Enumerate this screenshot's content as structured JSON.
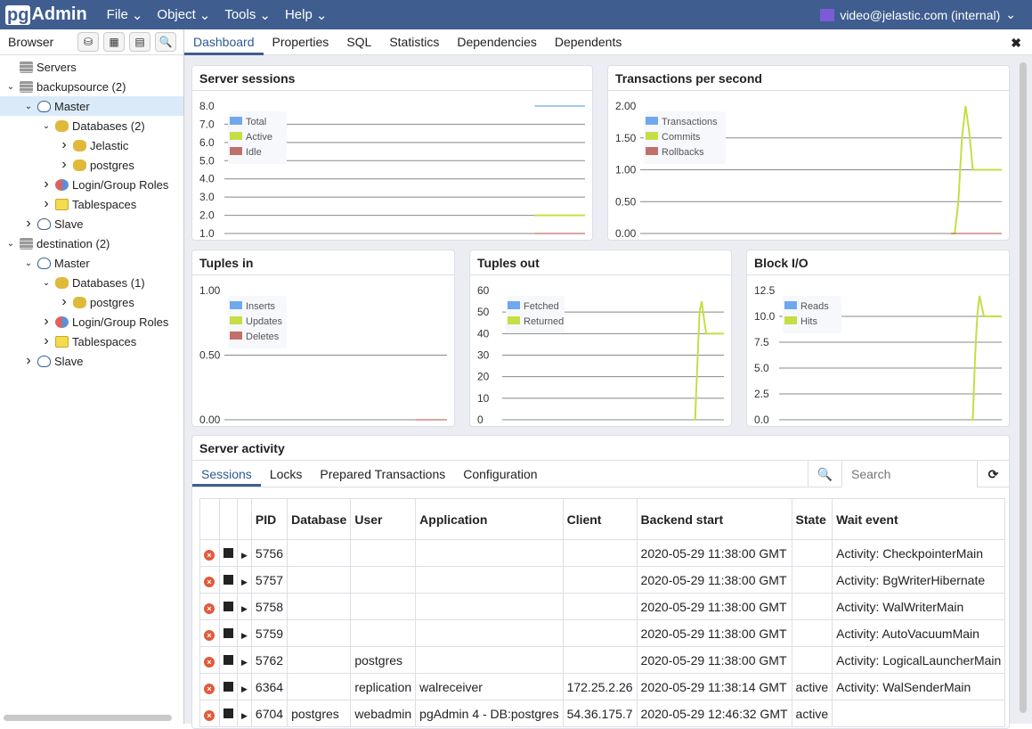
{
  "nav": {
    "logo": "pgAdmin",
    "logo_pg": "pg",
    "logo_rest": "Admin",
    "menus": [
      "File",
      "Object",
      "Tools",
      "Help"
    ],
    "user": "video@jelastic.com (internal)"
  },
  "browser": {
    "title": "Browser",
    "tree": [
      {
        "label": "Servers",
        "level": 0,
        "icon": "servers",
        "arrow": ""
      },
      {
        "label": "backupsource (2)",
        "level": 0,
        "icon": "servers",
        "arrow": "down"
      },
      {
        "label": "Master",
        "level": 1,
        "icon": "pg",
        "arrow": "down",
        "selected": true
      },
      {
        "label": "Databases (2)",
        "level": 2,
        "icon": "db",
        "arrow": "down"
      },
      {
        "label": "Jelastic",
        "level": 3,
        "icon": "db",
        "arrow": "right"
      },
      {
        "label": "postgres",
        "level": 3,
        "icon": "db",
        "arrow": "right"
      },
      {
        "label": "Login/Group Roles",
        "level": 2,
        "icon": "role",
        "arrow": "right"
      },
      {
        "label": "Tablespaces",
        "level": 2,
        "icon": "ts",
        "arrow": "right"
      },
      {
        "label": "Slave",
        "level": 1,
        "icon": "pg",
        "arrow": "right"
      },
      {
        "label": "destination (2)",
        "level": 0,
        "icon": "servers",
        "arrow": "down"
      },
      {
        "label": "Master",
        "level": 1,
        "icon": "pg",
        "arrow": "down"
      },
      {
        "label": "Databases (1)",
        "level": 2,
        "icon": "db",
        "arrow": "down"
      },
      {
        "label": "postgres",
        "level": 3,
        "icon": "db",
        "arrow": "right"
      },
      {
        "label": "Login/Group Roles",
        "level": 2,
        "icon": "role",
        "arrow": "right"
      },
      {
        "label": "Tablespaces",
        "level": 2,
        "icon": "ts",
        "arrow": "right"
      },
      {
        "label": "Slave",
        "level": 1,
        "icon": "pg",
        "arrow": "right"
      }
    ]
  },
  "tabs": [
    "Dashboard",
    "Properties",
    "SQL",
    "Statistics",
    "Dependencies",
    "Dependents"
  ],
  "colors": {
    "nav": "#3f5e8f",
    "blue": "#6fa8ef",
    "green": "#c6de45",
    "red": "#c0706a"
  },
  "chart_data": [
    {
      "type": "line",
      "title": "Server sessions",
      "yticks": [
        "8.0",
        "7.0",
        "6.0",
        "5.0",
        "4.0",
        "3.0",
        "2.0",
        "1.0"
      ],
      "ylim": [
        1,
        8
      ],
      "xlim": [
        0,
        100
      ],
      "series": [
        {
          "name": "Total",
          "color": "#6fa8ef",
          "points": [
            [
              86,
              8
            ],
            [
              100,
              8
            ]
          ]
        },
        {
          "name": "Active",
          "color": "#c6de45",
          "points": [
            [
              86,
              2
            ],
            [
              100,
              2
            ]
          ]
        },
        {
          "name": "Idle",
          "color": "#c0706a",
          "points": [
            [
              86,
              1
            ],
            [
              100,
              1
            ]
          ]
        }
      ]
    },
    {
      "type": "line",
      "title": "Transactions per second",
      "yticks": [
        "2.00",
        "1.50",
        "1.00",
        "0.50",
        "0.00"
      ],
      "ylim": [
        0,
        2
      ],
      "xlim": [
        0,
        100
      ],
      "series": [
        {
          "name": "Transactions",
          "color": "#6fa8ef",
          "points": []
        },
        {
          "name": "Commits",
          "color": "#c6de45",
          "points": [
            [
              86,
              0
            ],
            [
              87,
              0
            ],
            [
              88,
              0.5
            ],
            [
              89,
              1.5
            ],
            [
              90,
              2
            ],
            [
              91,
              1.6
            ],
            [
              92,
              1
            ],
            [
              100,
              1
            ]
          ]
        },
        {
          "name": "Rollbacks",
          "color": "#c0706a",
          "points": [
            [
              86,
              0
            ],
            [
              100,
              0
            ]
          ]
        }
      ]
    },
    {
      "type": "line",
      "title": "Tuples in",
      "yticks": [
        "1.00",
        "0.50",
        "0.00"
      ],
      "ylim": [
        0,
        1
      ],
      "xlim": [
        0,
        100
      ],
      "series": [
        {
          "name": "Inserts",
          "color": "#6fa8ef",
          "points": []
        },
        {
          "name": "Updates",
          "color": "#c6de45",
          "points": []
        },
        {
          "name": "Deletes",
          "color": "#c0706a",
          "points": [
            [
              86,
              0
            ],
            [
              100,
              0
            ]
          ]
        }
      ]
    },
    {
      "type": "line",
      "title": "Tuples out",
      "yticks": [
        "60",
        "50",
        "40",
        "30",
        "20",
        "10",
        "0"
      ],
      "ylim": [
        0,
        60
      ],
      "xlim": [
        0,
        100
      ],
      "series": [
        {
          "name": "Fetched",
          "color": "#6fa8ef",
          "points": []
        },
        {
          "name": "Returned",
          "color": "#c6de45",
          "points": [
            [
              86,
              0
            ],
            [
              87,
              0
            ],
            [
              88,
              25
            ],
            [
              89,
              50
            ],
            [
              90,
              55
            ],
            [
              91,
              47
            ],
            [
              92,
              40
            ],
            [
              100,
              40
            ]
          ]
        }
      ]
    },
    {
      "type": "line",
      "title": "Block I/O",
      "yticks": [
        "12.5",
        "10.0",
        "7.5",
        "5.0",
        "2.5",
        "0.0"
      ],
      "ylim": [
        0,
        12.5
      ],
      "xlim": [
        0,
        100
      ],
      "series": [
        {
          "name": "Reads",
          "color": "#6fa8ef",
          "points": []
        },
        {
          "name": "Hits",
          "color": "#c6de45",
          "points": [
            [
              86,
              0
            ],
            [
              87,
              0
            ],
            [
              88,
              6
            ],
            [
              89,
              10
            ],
            [
              90,
              12
            ],
            [
              91,
              11
            ],
            [
              92,
              10
            ],
            [
              100,
              10
            ]
          ]
        }
      ]
    }
  ],
  "activity": {
    "title": "Server activity",
    "tabs": [
      "Sessions",
      "Locks",
      "Prepared Transactions",
      "Configuration"
    ],
    "search_placeholder": "Search",
    "columns": [
      "PID",
      "Database",
      "User",
      "Application",
      "Client",
      "Backend start",
      "State",
      "Wait event"
    ],
    "rows": [
      [
        "5756",
        "",
        "",
        "",
        "",
        "2020-05-29 11:38:00 GMT",
        "",
        "Activity: CheckpointerMain"
      ],
      [
        "5757",
        "",
        "",
        "",
        "",
        "2020-05-29 11:38:00 GMT",
        "",
        "Activity: BgWriterHibernate"
      ],
      [
        "5758",
        "",
        "",
        "",
        "",
        "2020-05-29 11:38:00 GMT",
        "",
        "Activity: WalWriterMain"
      ],
      [
        "5759",
        "",
        "",
        "",
        "",
        "2020-05-29 11:38:00 GMT",
        "",
        "Activity: AutoVacuumMain"
      ],
      [
        "5762",
        "",
        "postgres",
        "",
        "",
        "2020-05-29 11:38:00 GMT",
        "",
        "Activity: LogicalLauncherMain"
      ],
      [
        "6364",
        "",
        "replication",
        "walreceiver",
        "172.25.2.26",
        "2020-05-29 11:38:14 GMT",
        "active",
        "Activity: WalSenderMain"
      ],
      [
        "6704",
        "postgres",
        "webadmin",
        "pgAdmin 4 - DB:postgres",
        "54.36.175.7",
        "2020-05-29 12:46:32 GMT",
        "active",
        ""
      ]
    ]
  }
}
